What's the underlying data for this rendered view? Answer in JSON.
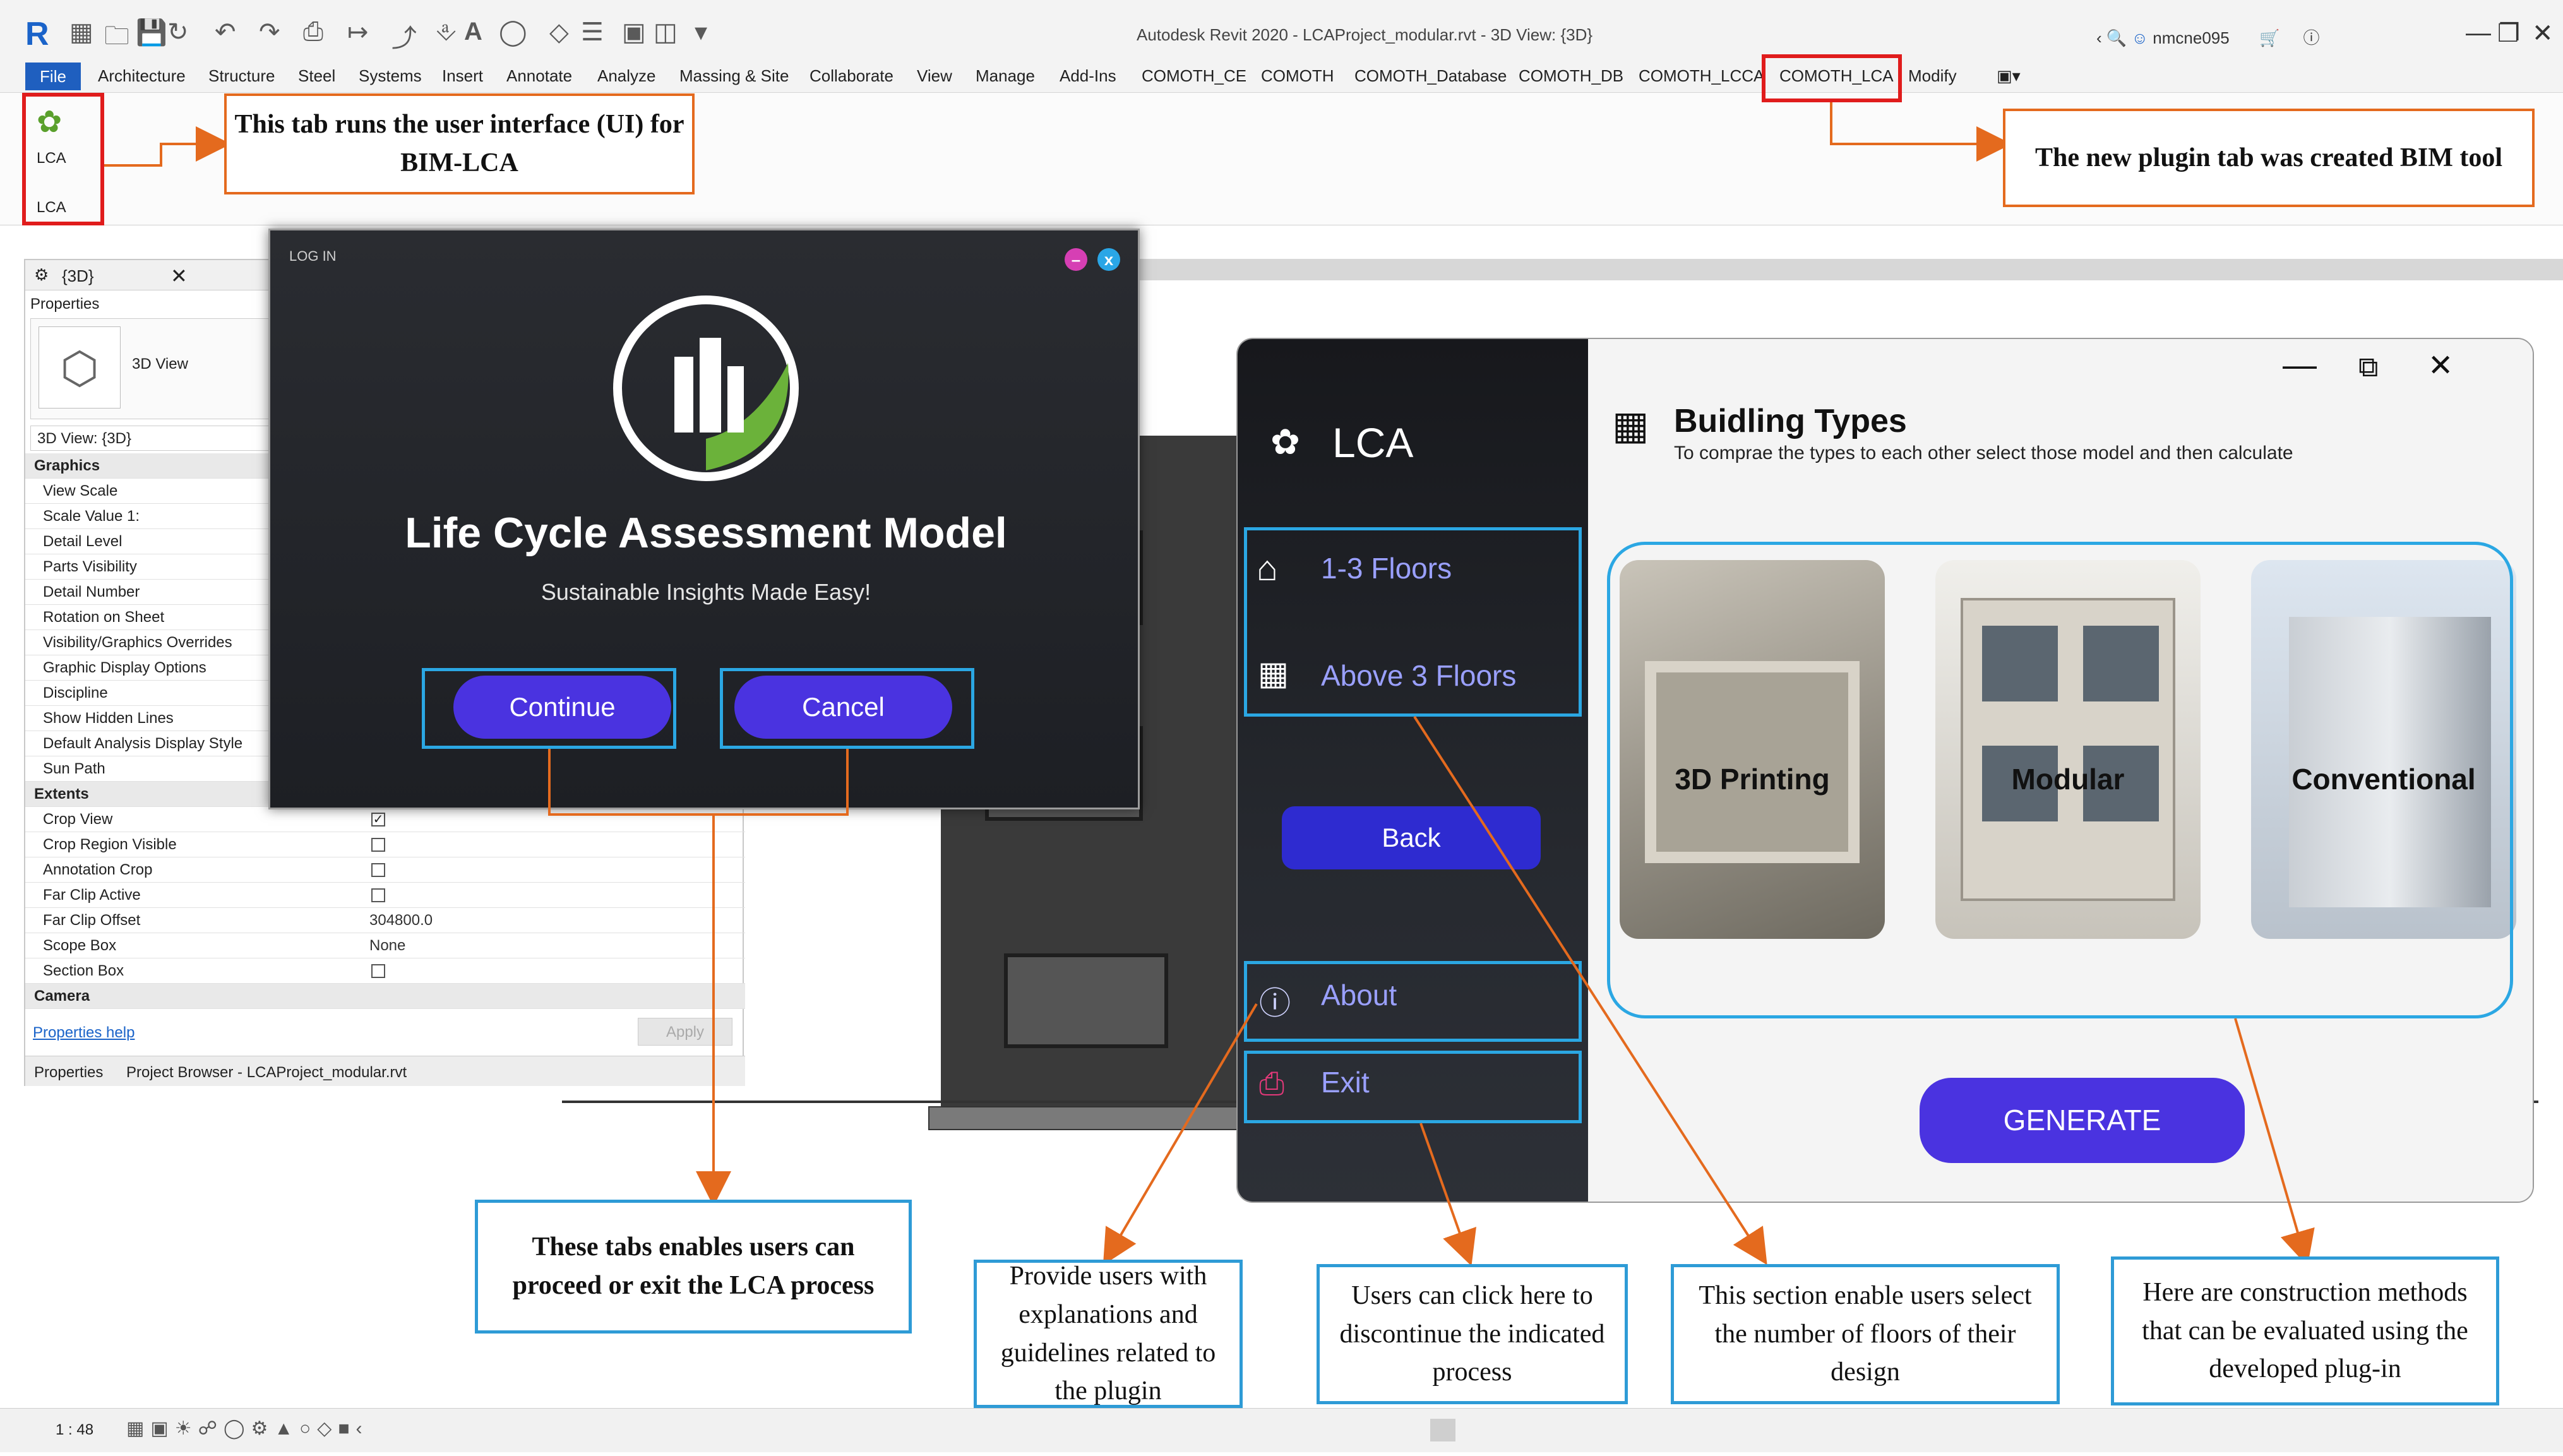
{
  "window": {
    "title": "Autodesk Revit 2020 - LCAProject_modular.rvt - 3D View: {3D}",
    "user": "nmcne095"
  },
  "menu": {
    "file": "File",
    "tabs": [
      "Architecture",
      "Structure",
      "Steel",
      "Systems",
      "Insert",
      "Annotate",
      "Analyze",
      "Massing & Site",
      "Collaborate",
      "View",
      "Manage",
      "Add-Ins",
      "COMOTH_CE",
      "COMOTH",
      "COMOTH_Database",
      "COMOTH_DB",
      "COMOTH_LCCA",
      "COMOTH_LCA",
      "Modify"
    ]
  },
  "ribbon": {
    "button_label": "LCA",
    "panel_label": "LCA"
  },
  "properties": {
    "tab_title": "{3D}",
    "header": "Properties",
    "type_name": "3D View",
    "instance_selector": "3D View: {3D}",
    "rows": [
      {
        "kind": "group",
        "label": "Graphics"
      },
      {
        "kind": "row",
        "label": "View Scale",
        "value": ""
      },
      {
        "kind": "row",
        "label": "Scale Value    1:",
        "value": ""
      },
      {
        "kind": "row",
        "label": "Detail Level",
        "value": ""
      },
      {
        "kind": "row",
        "label": "Parts Visibility",
        "value": ""
      },
      {
        "kind": "row",
        "label": "Detail Number",
        "value": ""
      },
      {
        "kind": "row",
        "label": "Rotation on Sheet",
        "value": ""
      },
      {
        "kind": "row",
        "label": "Visibility/Graphics Overrides",
        "value": ""
      },
      {
        "kind": "row",
        "label": "Graphic Display Options",
        "value": ""
      },
      {
        "kind": "row",
        "label": "Discipline",
        "value": ""
      },
      {
        "kind": "row",
        "label": "Show Hidden Lines",
        "value": ""
      },
      {
        "kind": "row",
        "label": "Default Analysis Display Style",
        "value": ""
      },
      {
        "kind": "row",
        "label": "Sun Path",
        "value": ""
      },
      {
        "kind": "group",
        "label": "Extents"
      },
      {
        "kind": "check",
        "label": "Crop View",
        "checked": true
      },
      {
        "kind": "check",
        "label": "Crop Region Visible",
        "checked": false
      },
      {
        "kind": "check",
        "label": "Annotation Crop",
        "checked": false
      },
      {
        "kind": "check",
        "label": "Far Clip Active",
        "checked": false
      },
      {
        "kind": "row",
        "label": "Far Clip Offset",
        "value": "304800.0"
      },
      {
        "kind": "row",
        "label": "Scope Box",
        "value": "None"
      },
      {
        "kind": "check",
        "label": "Section Box",
        "checked": false
      },
      {
        "kind": "group",
        "label": "Camera"
      }
    ],
    "help_link": "Properties help",
    "apply": "Apply",
    "bottom_tab_properties": "Properties",
    "bottom_tab_browser": "Project Browser - LCAProject_modular.rvt"
  },
  "login": {
    "caption": "LOG IN",
    "title": "Life Cycle Assessment Model",
    "subtitle": "Sustainable Insights Made Easy!",
    "continue": "Continue",
    "cancel": "Cancel",
    "minimize": "–",
    "close": "x"
  },
  "lca": {
    "brand": "LCA",
    "nav": {
      "floors_low": "1-3 Floors",
      "floors_high": "Above 3 Floors",
      "back": "Back",
      "about": "About",
      "exit": "Exit"
    },
    "heading": "Buidling Types",
    "subheading": "To comprae the types to each other select those model and then calculate",
    "cards": [
      "3D Printing",
      "Modular",
      "Conventional"
    ],
    "generate": "GENERATE"
  },
  "callouts": {
    "ui_tab": "This tab runs the user interface (UI) for BIM-LCA",
    "plugin_tab": "The new plugin  tab was created BIM tool",
    "proceed_exit": "These tabs enables users can proceed or exit the LCA process",
    "about": "Provide users with explanations and guidelines related to the plugin",
    "exit": "Users can click here to discontinue the indicated process",
    "floors": "This section enable users select the number of floors of their design",
    "methods": "Here are construction methods that can be evaluated using the developed plug-in"
  },
  "statusbar": {
    "scale": "1 : 48"
  },
  "colors": {
    "accent_purple": "#4a33e0",
    "highlight_red": "#e01c1c",
    "callout_orange": "#e46a1e",
    "callout_blue": "#2e9bd6"
  }
}
